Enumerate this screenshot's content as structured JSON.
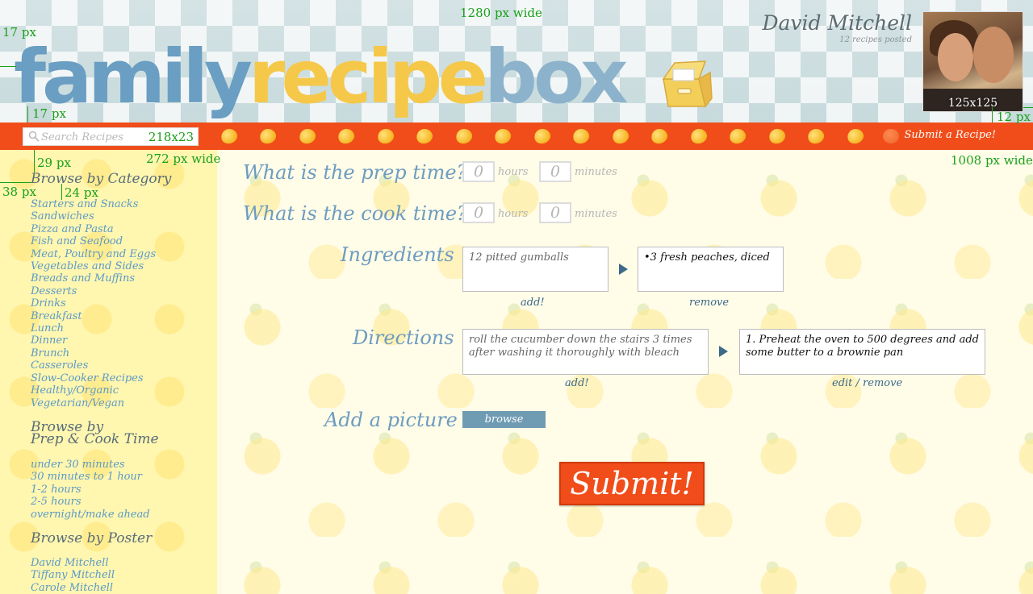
{
  "site": {
    "logo_words": [
      "family",
      "recipe",
      "box"
    ],
    "user_name": "David Mitchell",
    "user_sub": "12 recipes posted",
    "avatar_label": "125x125"
  },
  "topbar": {
    "search_placeholder": "Search Recipes",
    "search_dim": "218x23",
    "submit_link": "Submit a Recipe!"
  },
  "sidebar": {
    "category_heading": "Browse by Category",
    "categories": [
      "Starters and Snacks",
      "Sandwiches",
      "Pizza and Pasta",
      "Fish and Seafood",
      "Meat, Poultry and Eggs",
      "Vegetables and Sides",
      "Breads and Muffins",
      "Desserts",
      "Drinks",
      "Breakfast",
      "Lunch",
      "Dinner",
      "Brunch",
      "Casseroles",
      "Slow-Cooker Recipes",
      "Healthy/Organic",
      "Vegetarian/Vegan"
    ],
    "time_heading_1": "Browse by",
    "time_heading_2": "Prep & Cook Time",
    "times": [
      "under 30 minutes",
      "30 minutes to 1 hour",
      "1-2 hours",
      "2-5 hours",
      "overnight/make ahead"
    ],
    "poster_heading": "Browse by Poster",
    "posters": [
      "David Mitchell",
      "Tiffany Mitchell",
      "Carole Mitchell"
    ]
  },
  "form": {
    "prep_label": "What is the prep time?",
    "cook_label": "What is the cook time?",
    "prep_hours": "0",
    "prep_minutes": "0",
    "cook_hours": "0",
    "cook_minutes": "0",
    "hours_unit": "hours",
    "minutes_unit": "minutes",
    "ingredients_label": "Ingredients",
    "ingredient_input": "12 pitted gumballs",
    "ingredient_list_item": "3 fresh peaches, diced",
    "ingredient_add": "add!",
    "ingredient_remove": "remove",
    "directions_label": "Directions",
    "direction_input": "roll the cucumber down the stairs 3 times after washing it thoroughly with bleach",
    "direction_list_item": "1. Preheat the oven to 500 degrees and add some butter to a brownie pan",
    "direction_add": "add!",
    "direction_edit_remove": "edit / remove",
    "picture_label": "Add a picture",
    "browse_button": "browse",
    "submit_button": "Submit!"
  },
  "annotations": {
    "page_width": "1280 px wide",
    "logo_top": "17 px",
    "logo_bottom": "17 px",
    "avatar_gap": "12 px",
    "sidebar_top": "29 px",
    "sidebar_width": "272 px wide",
    "sidebar_left": "38 px",
    "sidebar_gap": "24 px",
    "main_width": "1008 px wide"
  },
  "colors": {
    "red_bar": "#f04d1a",
    "logo_blue": "#6a9ec2",
    "logo_yellow": "#f5c84a",
    "annotation_green": "#1aa01a",
    "sidebar_yellow": "#fff6b0"
  }
}
